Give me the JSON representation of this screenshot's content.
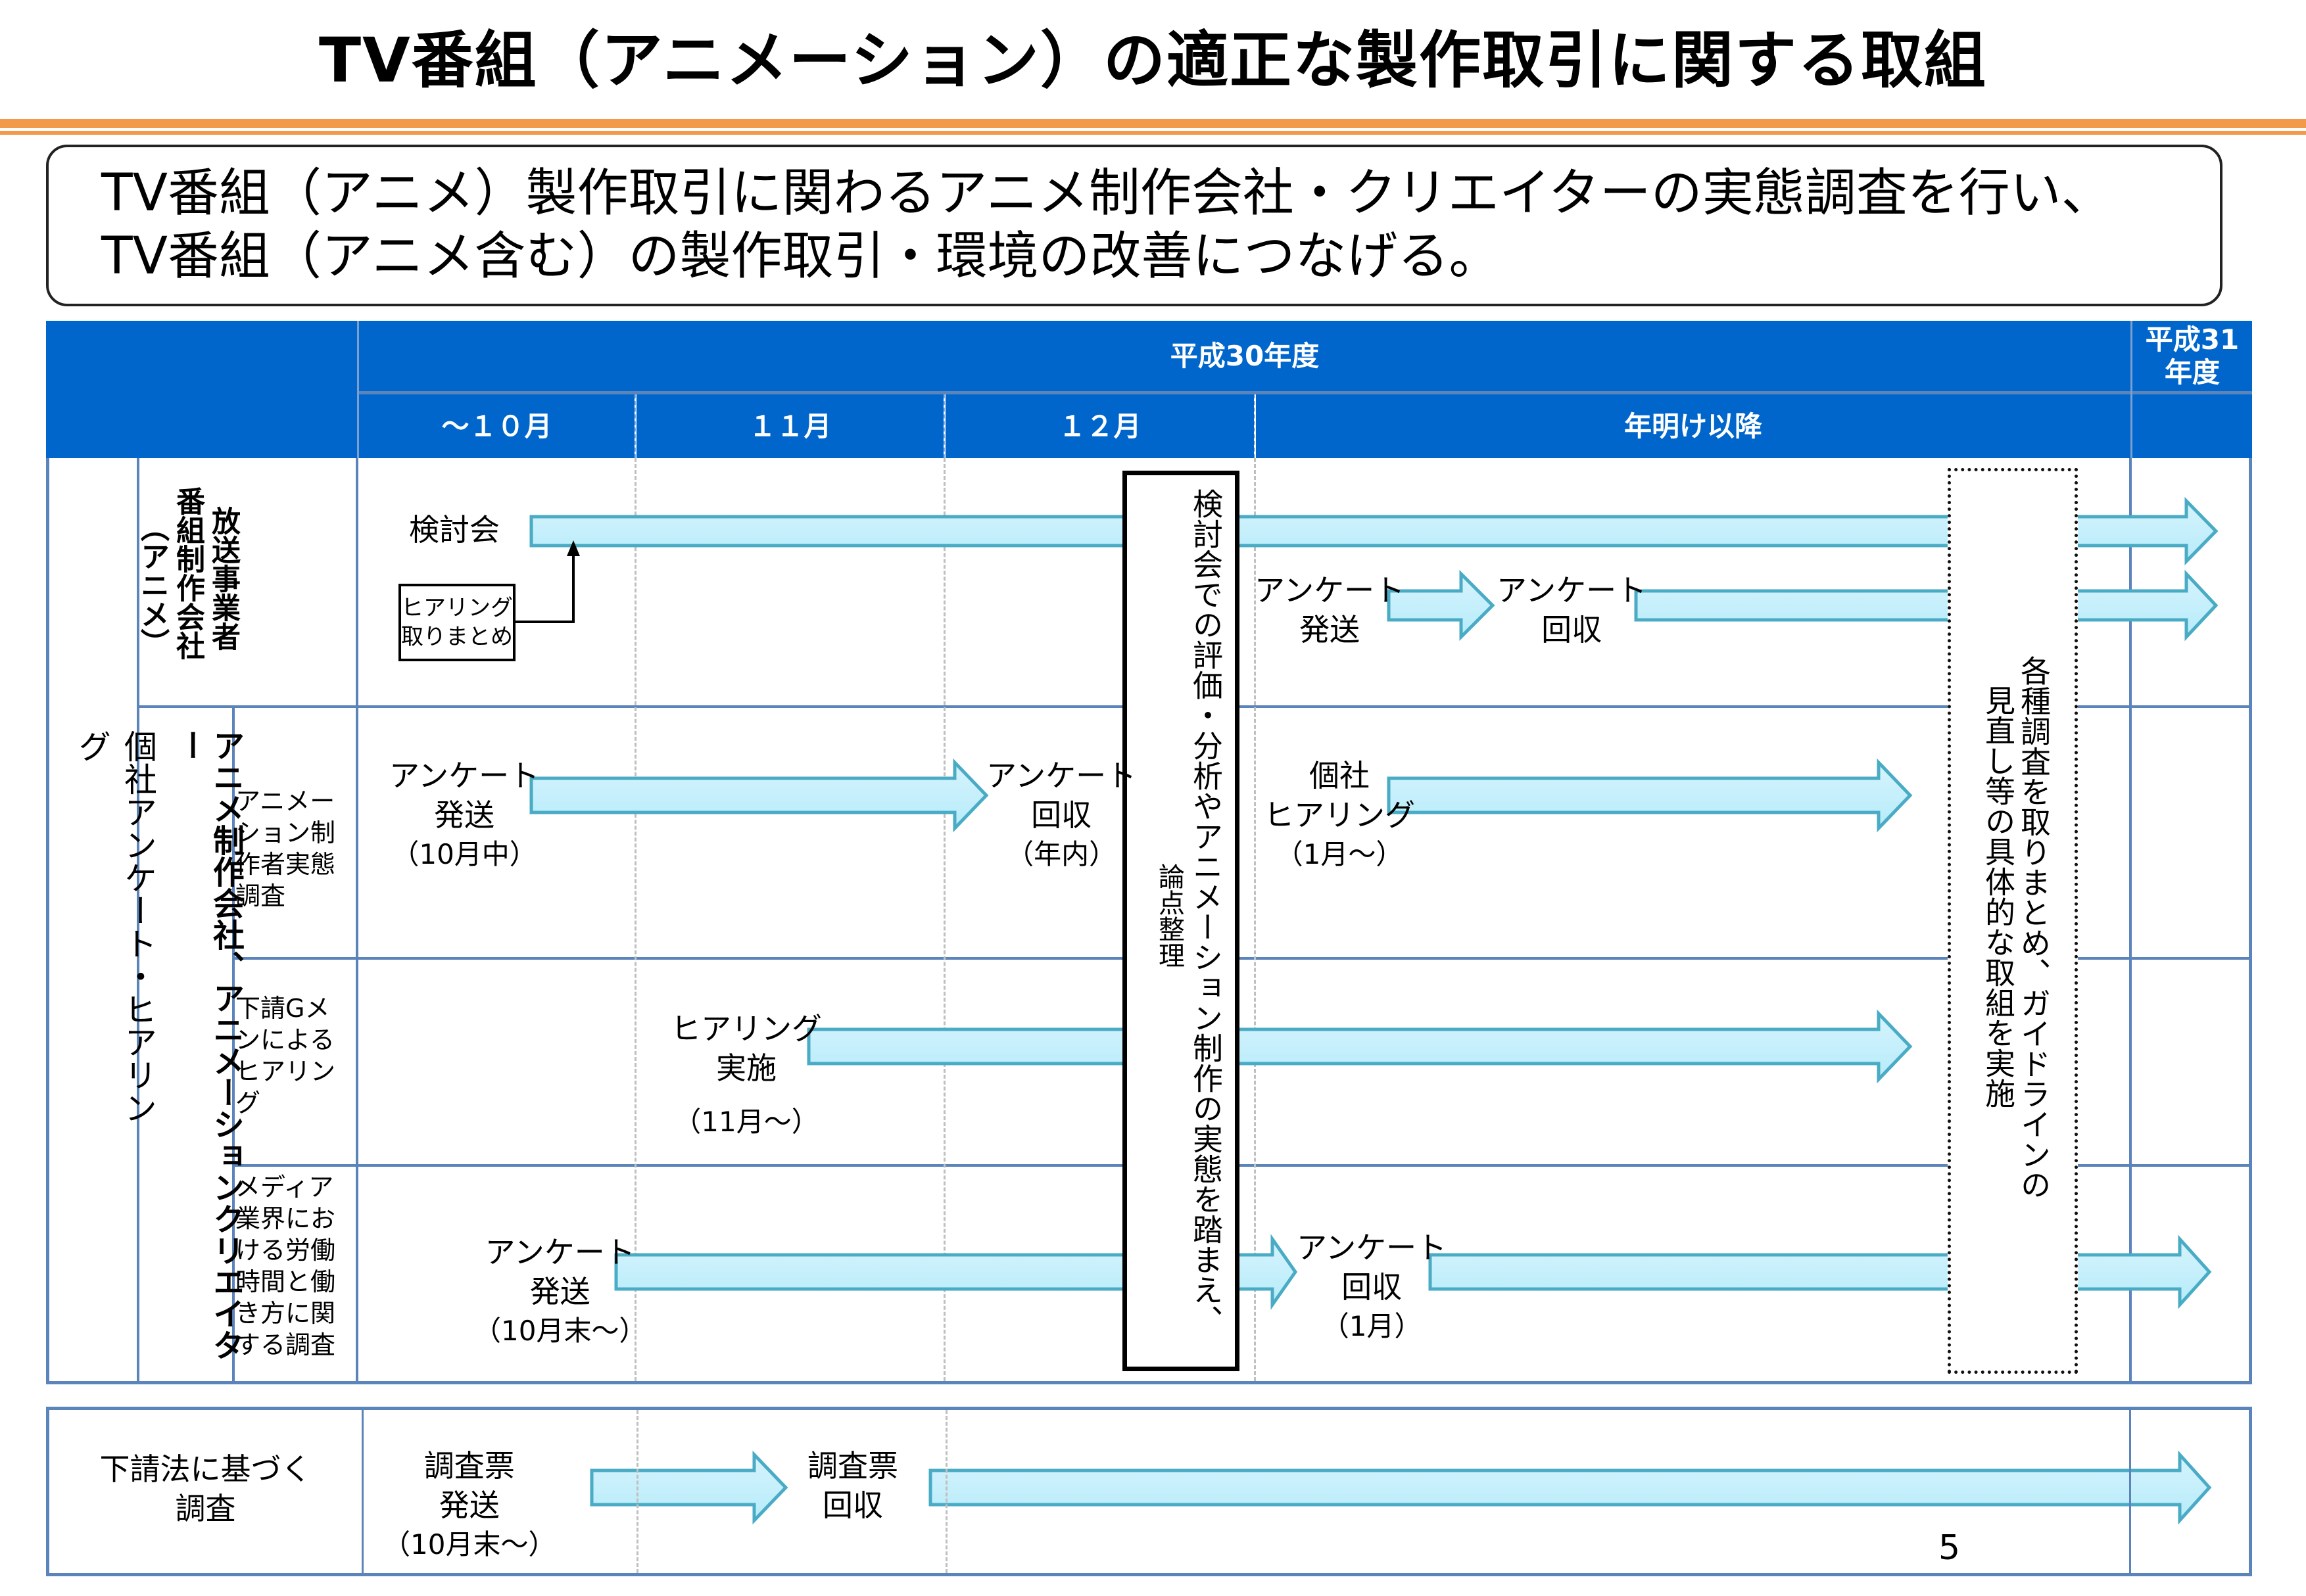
{
  "title": "TV番組（アニメーション）の適正な製作取引に関する取組",
  "summary": {
    "line1": "TV番組（アニメ）製作取引に関わるアニメ制作会社・クリエイターの実態調査を行い、",
    "line2": "TV番組（アニメ含む）の製作取引・環境の改善につなげる。"
  },
  "header": {
    "fiscal_year_current": "平成30年度",
    "fiscal_year_next_line1": "平成31",
    "fiscal_year_next_line2": "年度",
    "periods": [
      "～１０月",
      "１１月",
      "１２月",
      "年明け以降"
    ]
  },
  "left_labels": {
    "outer": "個社アンケート・ヒアリング",
    "broadcaster": {
      "line1": "放送事業者",
      "line2": "番組制作会社",
      "line3": "（アニメ）"
    },
    "anime_group": "アニメ制作会社、アニメーションクリエイター",
    "sub_rows": [
      "アニメーション制作者実態調査",
      "下請Gメンによるヒアリング",
      "メディア業界における労働時間と働き方に関する調査"
    ],
    "subcontract_law": {
      "line1": "下請法に基づく",
      "line2": "調査"
    }
  },
  "rows": {
    "broadcaster": {
      "meeting_label": "検討会",
      "hearing_box": {
        "line1": "ヒアリング",
        "line2": "取りまとめ"
      },
      "survey_send": {
        "line1": "アンケート",
        "line2": "発送"
      },
      "survey_collect": {
        "line1": "アンケート",
        "line2": "回収"
      }
    },
    "anime_survey": {
      "send": {
        "line1": "アンケート",
        "line2": "発送",
        "note": "（10月中）"
      },
      "collect": {
        "line1": "アンケート",
        "line2": "回収",
        "note": "（年内）"
      },
      "hearing": {
        "line1": "個社",
        "line2": "ヒアリング",
        "note": "（1月～）"
      }
    },
    "gmen": {
      "hearing": {
        "line1": "ヒアリング",
        "line2": "実施",
        "note": "（11月～）"
      }
    },
    "media": {
      "send": {
        "line1": "アンケート",
        "line2": "発送",
        "note": "（10月末～）"
      },
      "collect": {
        "line1": "アンケート",
        "line2": "回収",
        "note": "（1月）"
      }
    },
    "subcontract": {
      "send": {
        "line1": "調査票",
        "line2": "発送",
        "note": "（10月末～）"
      },
      "collect": {
        "line1": "調査票",
        "line2": "回収"
      }
    }
  },
  "meeting_box": {
    "main": "検討会での評価・分析やアニメーション制作の実態を踏まえ、",
    "sub": "論点整理"
  },
  "summary_box": {
    "line1": "各種調査を取りまとめ、ガイドラインの",
    "line2": "見直し等の具体的な取組を実施"
  },
  "page_number": "5",
  "colors": {
    "header_blue": "#0066cc",
    "grid_blue": "#5b84bb",
    "arrow_fill": "#c8f0fb",
    "arrow_stroke": "#4aabc5",
    "orange": "#f29a4a"
  }
}
